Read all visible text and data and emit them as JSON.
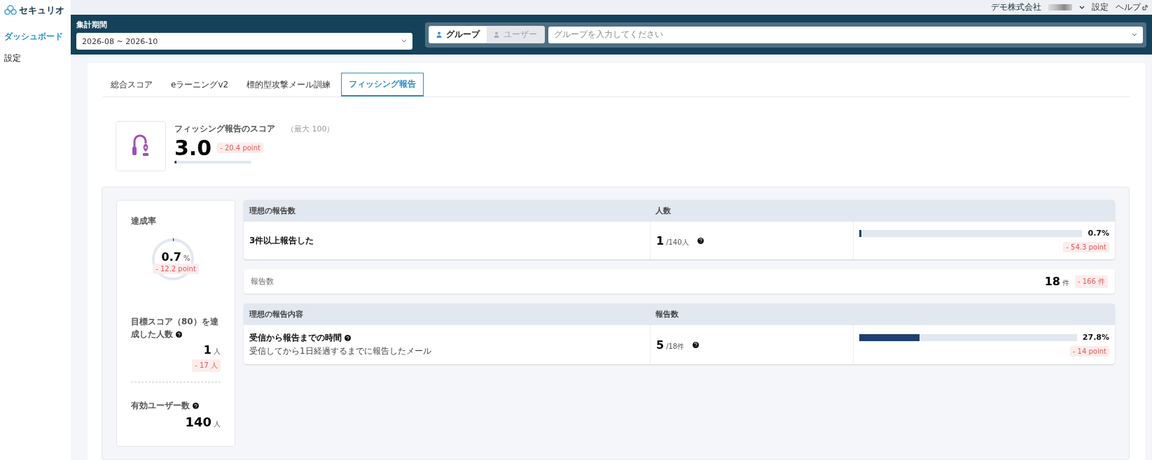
{
  "sidebar": {
    "logo": "セキュリオ",
    "items": [
      {
        "label": "ダッシュボード",
        "selected": true
      },
      {
        "label": "設定",
        "selected": false
      }
    ]
  },
  "top_bar": {
    "company": "デモ株式会社",
    "links": [
      {
        "label": "設定",
        "external": false
      },
      {
        "label": "ヘルプ",
        "external": true
      }
    ]
  },
  "filters": {
    "period_label": "集計期間",
    "period_value": "2026-08 ~ 2026-10",
    "target_options": [
      {
        "label": "グループ",
        "selected": true
      },
      {
        "label": "ユーザー",
        "selected": false
      }
    ],
    "target_placeholder": "グループを入力してください"
  },
  "tabs": [
    {
      "label": "総合スコア",
      "selected": false
    },
    {
      "label": "eラーニングv2",
      "selected": false
    },
    {
      "label": "標的型攻撃メール訓練",
      "selected": false
    },
    {
      "label": "フィッシング報告",
      "selected": true
    }
  ],
  "score": {
    "title": "フィッシング報告のスコア",
    "max": "（最大 100）",
    "value": "3.0",
    "delta": "- 20.4 point",
    "level": 0.03
  },
  "summary": {
    "rate_label": "達成率",
    "rate_value": "0.7",
    "rate_unit": "%",
    "rate_delta": "- 12.2 point",
    "rate_ring": {
      "level": 0.007
    },
    "achievers_label": "目標スコア（80）を達成した人数",
    "achievers_value": "1",
    "achievers_unit": "人",
    "achievers_delta": "- 17 人",
    "achievers_help": true,
    "users_label": "有効ユーザー数",
    "users_value": "140",
    "users_unit": "人",
    "users_help": true
  },
  "count_table": {
    "columns": [
      "理想の報告数",
      "人数"
    ],
    "rows": [
      {
        "label": "3件以上報告した",
        "value": "1",
        "total": "/140人",
        "help": true,
        "level": 0.007,
        "percent": "0.7%",
        "delta": "- 54.3 point"
      }
    ]
  },
  "report_count": {
    "label": "報告数",
    "value": "18",
    "unit": "件",
    "delta": "- 166 件"
  },
  "content_table": {
    "columns": [
      "理想の報告内容",
      "報告数"
    ],
    "rows": [
      {
        "label": "受信から報告までの時間",
        "label_help": true,
        "note": "受信してから1日経過するまでに報告したメール",
        "value": "5",
        "total": "/18件",
        "help": true,
        "level": 0.278,
        "percent": "27.8%",
        "delta": "- 14 point"
      }
    ]
  }
}
